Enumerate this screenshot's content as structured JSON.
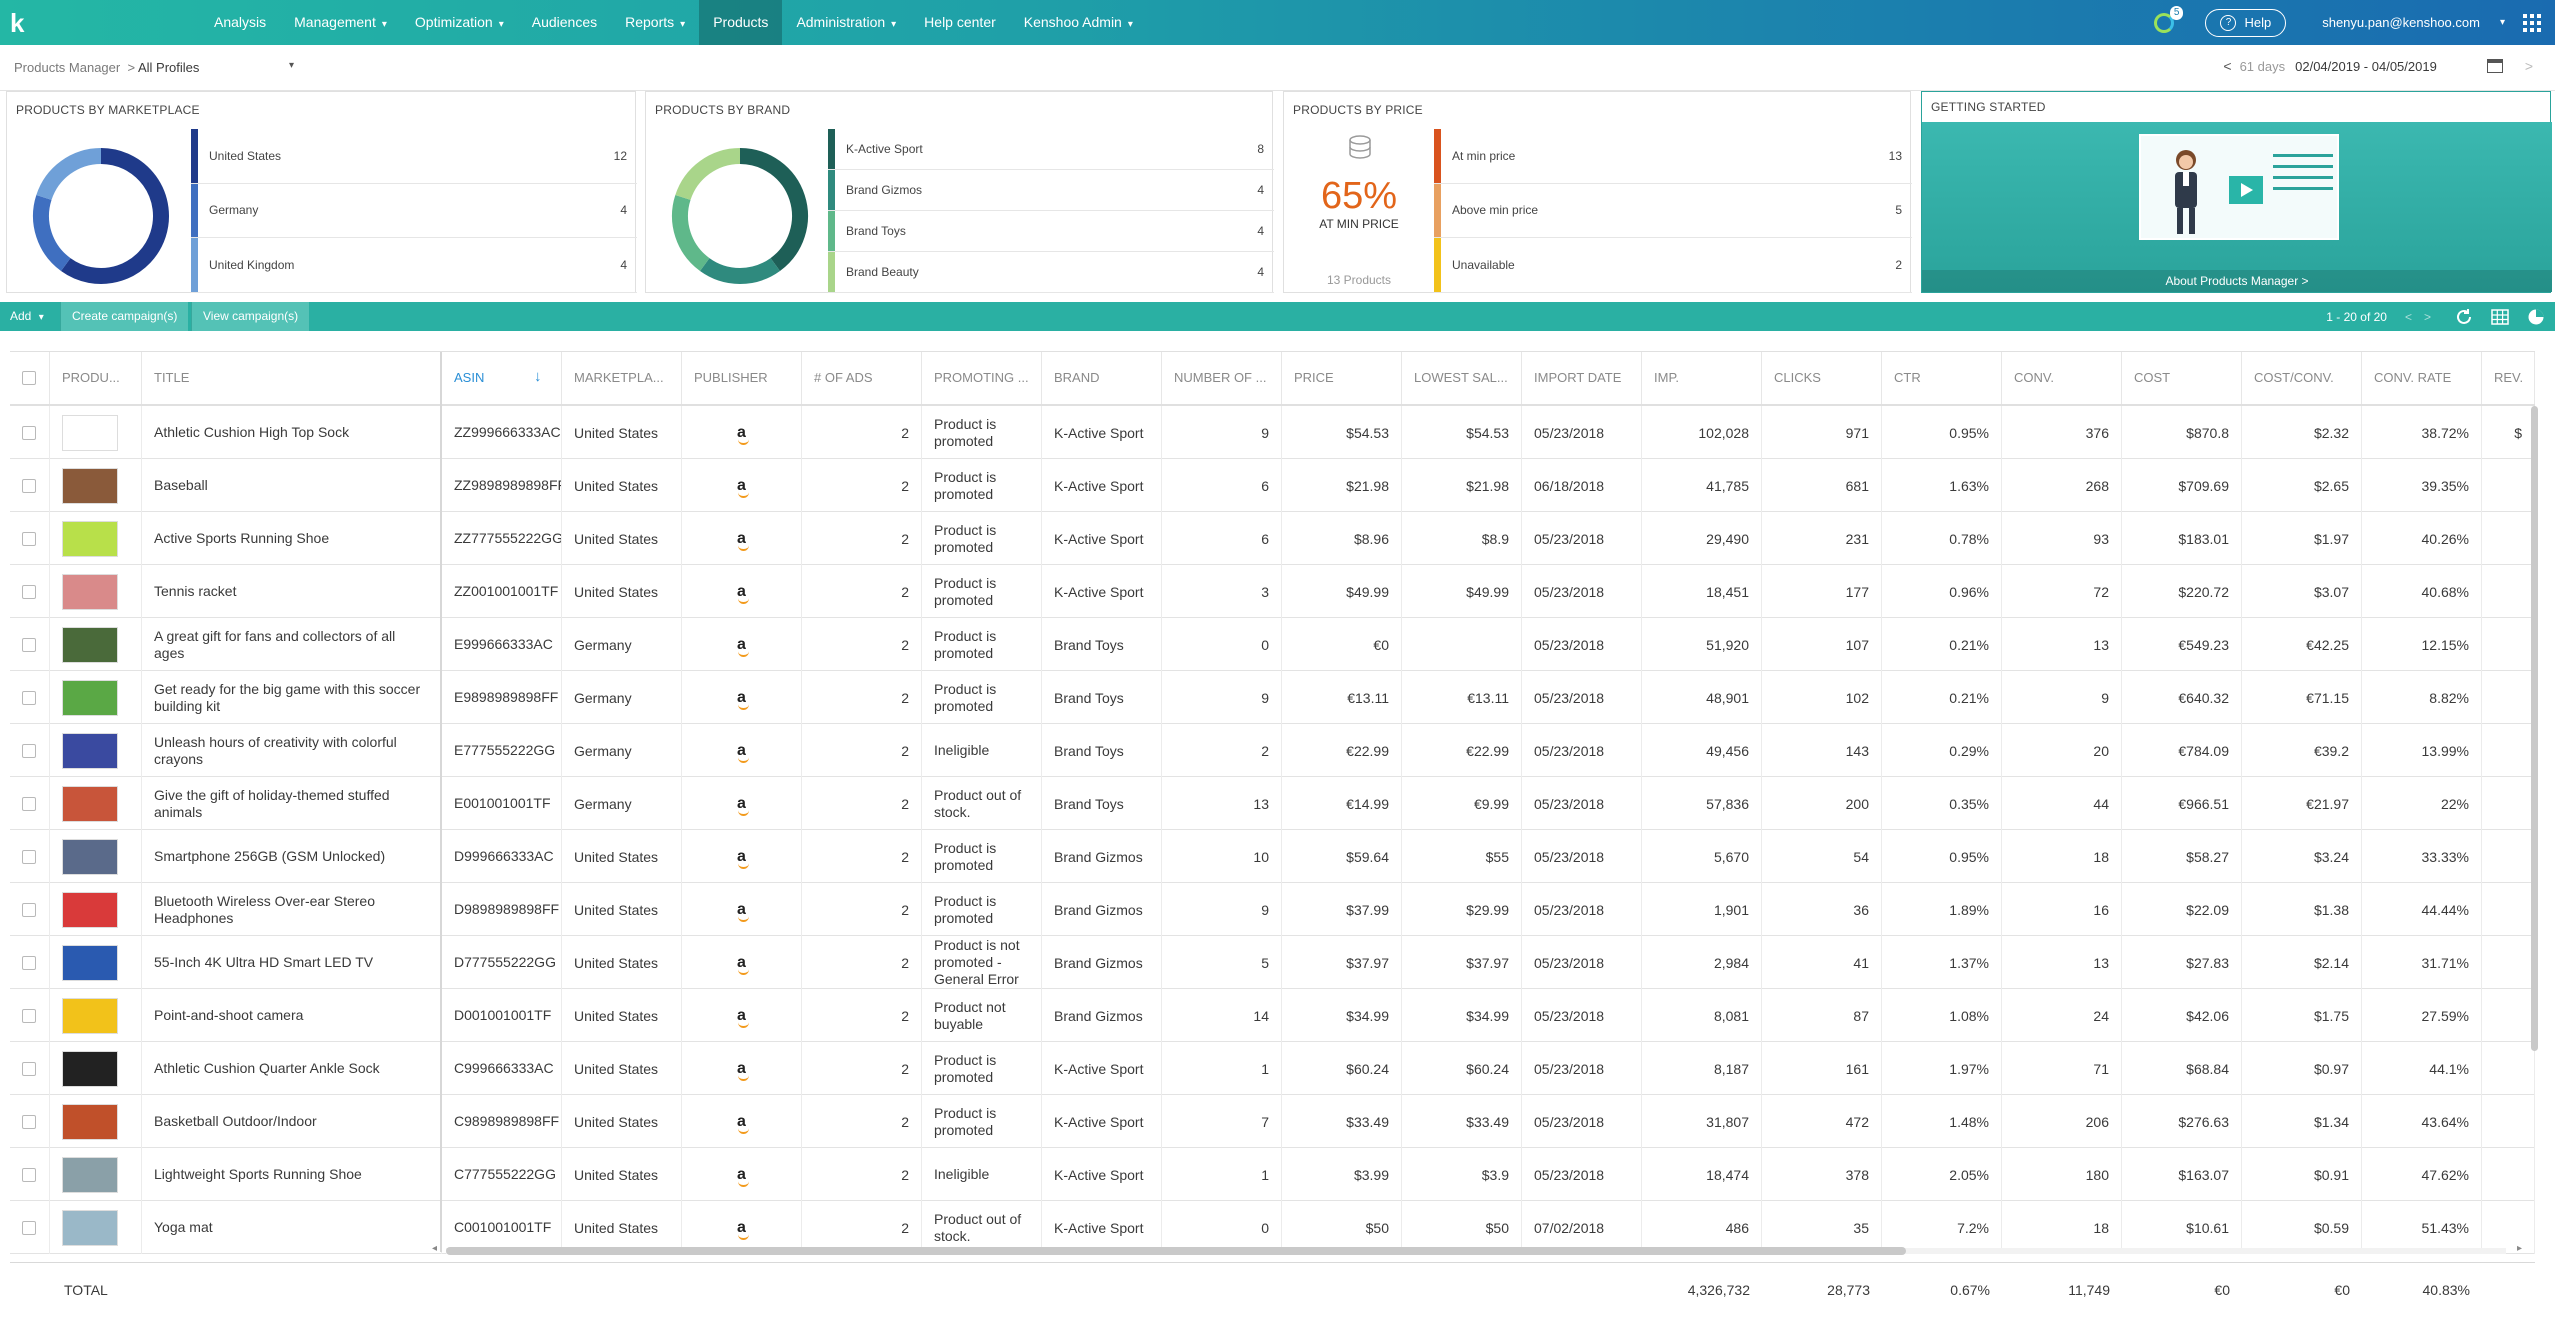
{
  "nav": {
    "logo": "k",
    "items": [
      {
        "label": "Analysis",
        "dropdown": false
      },
      {
        "label": "Management",
        "dropdown": true
      },
      {
        "label": "Optimization",
        "dropdown": true
      },
      {
        "label": "Audiences",
        "dropdown": false
      },
      {
        "label": "Reports",
        "dropdown": true
      },
      {
        "label": "Products",
        "dropdown": false,
        "active": true
      },
      {
        "label": "Administration",
        "dropdown": true
      },
      {
        "label": "Help center",
        "dropdown": false
      },
      {
        "label": "Kenshoo Admin",
        "dropdown": true
      }
    ],
    "notification_count": "5",
    "help_label": "Help",
    "user_email": "shenyu.pan@kenshoo.com"
  },
  "subbar": {
    "breadcrumb": "Products Manager",
    "profile_select": "All Profiles",
    "days": "61 days",
    "date_range": "02/04/2019 - 04/05/2019"
  },
  "widgets": {
    "marketplace": {
      "title": "PRODUCTS BY MARKETPLACE",
      "items": [
        {
          "name": "United States",
          "value": 12,
          "color": "#1f3a8a"
        },
        {
          "name": "Germany",
          "value": 4,
          "color": "#3f6fc0"
        },
        {
          "name": "United Kingdom",
          "value": 4,
          "color": "#6fa0d8"
        }
      ]
    },
    "brand": {
      "title": "PRODUCTS BY BRAND",
      "items": [
        {
          "name": "K-Active Sport",
          "value": 8,
          "color": "#1e5f57"
        },
        {
          "name": "Brand Gizmos",
          "value": 4,
          "color": "#2f8a7e"
        },
        {
          "name": "Brand Toys",
          "value": 4,
          "color": "#5fb88a"
        },
        {
          "name": "Brand Beauty",
          "value": 4,
          "color": "#a9d58a"
        }
      ]
    },
    "price": {
      "title": "PRODUCTS BY PRICE",
      "big_value": "65%",
      "big_label": "AT MIN PRICE",
      "footer": "13 Products",
      "items": [
        {
          "name": "At min price",
          "value": 13,
          "color": "#d9531e"
        },
        {
          "name": "Above min price",
          "value": 5,
          "color": "#e8a060"
        },
        {
          "name": "Unavailable",
          "value": 2,
          "color": "#f2c21a"
        }
      ]
    },
    "getting_started": {
      "title": "GETTING STARTED",
      "footer_link": "About Products Manager >"
    }
  },
  "toolbar": {
    "add_label": "Add",
    "create_campaigns": "Create campaign(s)",
    "view_campaigns": "View campaign(s)",
    "pagination": "1 - 20 of 20"
  },
  "table": {
    "columns": [
      "PRODU...",
      "TITLE",
      "ASIN",
      "MARKETPLA...",
      "PUBLISHER",
      "# OF ADS",
      "PROMOTING ...",
      "BRAND",
      "NUMBER OF ...",
      "PRICE",
      "LOWEST SAL...",
      "IMPORT DATE",
      "IMP.",
      "CLICKS",
      "CTR",
      "CONV.",
      "COST",
      "COST/CONV.",
      "CONV. RATE",
      "REV."
    ],
    "sorted_column": "ASIN",
    "publisher_glyph": "a",
    "rows": [
      {
        "thumb": "#ffffff",
        "title": "Athletic Cushion High Top Sock",
        "asin": "ZZ999666333AC",
        "market": "United States",
        "ads": "2",
        "promoting": "Product is promoted",
        "brand": "K-Active Sport",
        "number": "9",
        "price": "$54.53",
        "lowest": "$54.53",
        "date": "05/23/2018",
        "imp": "102,028",
        "clicks": "971",
        "ctr": "0.95%",
        "conv": "376",
        "cost": "$870.8",
        "cpc": "$2.32",
        "rate": "38.72%",
        "rev": "$"
      },
      {
        "thumb": "#8a5a3a",
        "title": "Baseball",
        "asin": "ZZ9898989898FF",
        "market": "United States",
        "ads": "2",
        "promoting": "Product is promoted",
        "brand": "K-Active Sport",
        "number": "6",
        "price": "$21.98",
        "lowest": "$21.98",
        "date": "06/18/2018",
        "imp": "41,785",
        "clicks": "681",
        "ctr": "1.63%",
        "conv": "268",
        "cost": "$709.69",
        "cpc": "$2.65",
        "rate": "39.35%",
        "rev": ""
      },
      {
        "thumb": "#b8e04a",
        "title": "Active Sports Running Shoe",
        "asin": "ZZ777555222GG",
        "market": "United States",
        "ads": "2",
        "promoting": "Product is promoted",
        "brand": "K-Active Sport",
        "number": "6",
        "price": "$8.96",
        "lowest": "$8.9",
        "date": "05/23/2018",
        "imp": "29,490",
        "clicks": "231",
        "ctr": "0.78%",
        "conv": "93",
        "cost": "$183.01",
        "cpc": "$1.97",
        "rate": "40.26%",
        "rev": ""
      },
      {
        "thumb": "#d98a8a",
        "title": "Tennis racket",
        "asin": "ZZ001001001TF",
        "market": "United States",
        "ads": "2",
        "promoting": "Product is promoted",
        "brand": "K-Active Sport",
        "number": "3",
        "price": "$49.99",
        "lowest": "$49.99",
        "date": "05/23/2018",
        "imp": "18,451",
        "clicks": "177",
        "ctr": "0.96%",
        "conv": "72",
        "cost": "$220.72",
        "cpc": "$3.07",
        "rate": "40.68%",
        "rev": ""
      },
      {
        "thumb": "#4a6a3a",
        "title": "A great gift for fans and collectors of all ages",
        "asin": "E999666333AC",
        "market": "Germany",
        "ads": "2",
        "promoting": "Product is promoted",
        "brand": "Brand Toys",
        "number": "0",
        "price": "€0",
        "lowest": "",
        "date": "05/23/2018",
        "imp": "51,920",
        "clicks": "107",
        "ctr": "0.21%",
        "conv": "13",
        "cost": "€549.23",
        "cpc": "€42.25",
        "rate": "12.15%",
        "rev": ""
      },
      {
        "thumb": "#5aa845",
        "title": "Get ready for the big game with this soccer building kit",
        "asin": "E9898989898FF",
        "market": "Germany",
        "ads": "2",
        "promoting": "Product is promoted",
        "brand": "Brand Toys",
        "number": "9",
        "price": "€13.11",
        "lowest": "€13.11",
        "date": "05/23/2018",
        "imp": "48,901",
        "clicks": "102",
        "ctr": "0.21%",
        "conv": "9",
        "cost": "€640.32",
        "cpc": "€71.15",
        "rate": "8.82%",
        "rev": ""
      },
      {
        "thumb": "#3a4aa0",
        "title": "Unleash hours of creativity with colorful crayons",
        "asin": "E777555222GG",
        "market": "Germany",
        "ads": "2",
        "promoting": "Ineligible",
        "brand": "Brand Toys",
        "number": "2",
        "price": "€22.99",
        "lowest": "€22.99",
        "date": "05/23/2018",
        "imp": "49,456",
        "clicks": "143",
        "ctr": "0.29%",
        "conv": "20",
        "cost": "€784.09",
        "cpc": "€39.2",
        "rate": "13.99%",
        "rev": ""
      },
      {
        "thumb": "#c8553a",
        "title": "Give the gift of holiday-themed stuffed animals",
        "asin": "E001001001TF",
        "market": "Germany",
        "ads": "2",
        "promoting": "Product out of stock.",
        "brand": "Brand Toys",
        "number": "13",
        "price": "€14.99",
        "lowest": "€9.99",
        "date": "05/23/2018",
        "imp": "57,836",
        "clicks": "200",
        "ctr": "0.35%",
        "conv": "44",
        "cost": "€966.51",
        "cpc": "€21.97",
        "rate": "22%",
        "rev": ""
      },
      {
        "thumb": "#5a6a8a",
        "title": "Smartphone 256GB (GSM Unlocked)",
        "asin": "D999666333AC",
        "market": "United States",
        "ads": "2",
        "promoting": "Product is promoted",
        "brand": "Brand Gizmos",
        "number": "10",
        "price": "$59.64",
        "lowest": "$55",
        "date": "05/23/2018",
        "imp": "5,670",
        "clicks": "54",
        "ctr": "0.95%",
        "conv": "18",
        "cost": "$58.27",
        "cpc": "$3.24",
        "rate": "33.33%",
        "rev": ""
      },
      {
        "thumb": "#d93a3a",
        "title": "Bluetooth Wireless Over-ear Stereo Headphones",
        "asin": "D9898989898FF",
        "market": "United States",
        "ads": "2",
        "promoting": "Product is promoted",
        "brand": "Brand Gizmos",
        "number": "9",
        "price": "$37.99",
        "lowest": "$29.99",
        "date": "05/23/2018",
        "imp": "1,901",
        "clicks": "36",
        "ctr": "1.89%",
        "conv": "16",
        "cost": "$22.09",
        "cpc": "$1.38",
        "rate": "44.44%",
        "rev": ""
      },
      {
        "thumb": "#2a5ab0",
        "title": "55-Inch 4K Ultra HD Smart LED TV",
        "asin": "D777555222GG",
        "market": "United States",
        "ads": "2",
        "promoting": "Product is not promoted - General Error",
        "brand": "Brand Gizmos",
        "number": "5",
        "price": "$37.97",
        "lowest": "$37.97",
        "date": "05/23/2018",
        "imp": "2,984",
        "clicks": "41",
        "ctr": "1.37%",
        "conv": "13",
        "cost": "$27.83",
        "cpc": "$2.14",
        "rate": "31.71%",
        "rev": ""
      },
      {
        "thumb": "#f2c21a",
        "title": "Point-and-shoot camera",
        "asin": "D001001001TF",
        "market": "United States",
        "ads": "2",
        "promoting": "Product not buyable",
        "brand": "Brand Gizmos",
        "number": "14",
        "price": "$34.99",
        "lowest": "$34.99",
        "date": "05/23/2018",
        "imp": "8,081",
        "clicks": "87",
        "ctr": "1.08%",
        "conv": "24",
        "cost": "$42.06",
        "cpc": "$1.75",
        "rate": "27.59%",
        "rev": ""
      },
      {
        "thumb": "#222222",
        "title": "Athletic Cushion Quarter Ankle Sock",
        "asin": "C999666333AC",
        "market": "United States",
        "ads": "2",
        "promoting": "Product is promoted",
        "brand": "K-Active Sport",
        "number": "1",
        "price": "$60.24",
        "lowest": "$60.24",
        "date": "05/23/2018",
        "imp": "8,187",
        "clicks": "161",
        "ctr": "1.97%",
        "conv": "71",
        "cost": "$68.84",
        "cpc": "$0.97",
        "rate": "44.1%",
        "rev": ""
      },
      {
        "thumb": "#c0502a",
        "title": "Basketball Outdoor/Indoor",
        "asin": "C9898989898FF",
        "market": "United States",
        "ads": "2",
        "promoting": "Product is promoted",
        "brand": "K-Active Sport",
        "number": "7",
        "price": "$33.49",
        "lowest": "$33.49",
        "date": "05/23/2018",
        "imp": "31,807",
        "clicks": "472",
        "ctr": "1.48%",
        "conv": "206",
        "cost": "$276.63",
        "cpc": "$1.34",
        "rate": "43.64%",
        "rev": ""
      },
      {
        "thumb": "#8aa0a8",
        "title": "Lightweight Sports Running Shoe",
        "asin": "C777555222GG",
        "market": "United States",
        "ads": "2",
        "promoting": "Ineligible",
        "brand": "K-Active Sport",
        "number": "1",
        "price": "$3.99",
        "lowest": "$3.9",
        "date": "05/23/2018",
        "imp": "18,474",
        "clicks": "378",
        "ctr": "2.05%",
        "conv": "180",
        "cost": "$163.07",
        "cpc": "$0.91",
        "rate": "47.62%",
        "rev": ""
      },
      {
        "thumb": "#9ab8c8",
        "title": "Yoga mat",
        "asin": "C001001001TF",
        "market": "United States",
        "ads": "2",
        "promoting": "Product out of stock.",
        "brand": "K-Active Sport",
        "number": "0",
        "price": "$50",
        "lowest": "$50",
        "date": "07/02/2018",
        "imp": "486",
        "clicks": "35",
        "ctr": "7.2%",
        "conv": "18",
        "cost": "$10.61",
        "cpc": "$0.59",
        "rate": "51.43%",
        "rev": ""
      }
    ],
    "total": {
      "label": "TOTAL",
      "imp": "4,326,732",
      "clicks": "28,773",
      "ctr": "0.67%",
      "conv": "11,749",
      "cost": "€0",
      "cpc": "€0",
      "rate": "40.83%"
    }
  }
}
